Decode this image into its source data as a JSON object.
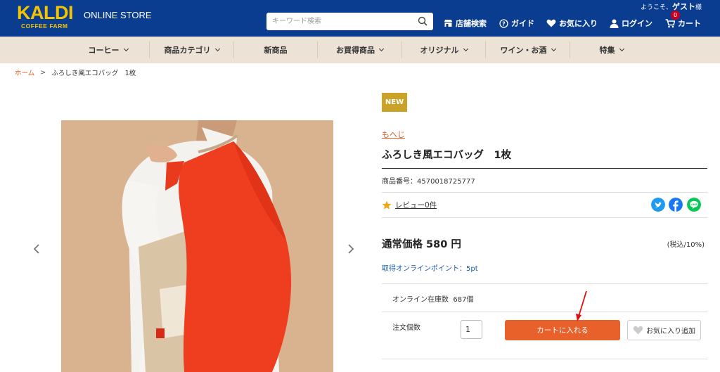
{
  "header": {
    "logo_main": "KALDI",
    "logo_sub": "COFFEE FARM",
    "store_label": "ONLINE STORE",
    "search_placeholder": "キーワード検索",
    "welcome_prefix": "ようこそ、",
    "welcome_user": "ゲスト",
    "welcome_suffix": "様",
    "nav": {
      "stores": "店舗検索",
      "guide": "ガイド",
      "favorites": "お気に入り",
      "login": "ログイン",
      "cart": "カート",
      "cart_count": "0"
    }
  },
  "category_nav": [
    {
      "label": "コーヒー",
      "dropdown": true
    },
    {
      "label": "商品カテゴリ",
      "dropdown": true
    },
    {
      "label": "新商品",
      "dropdown": false
    },
    {
      "label": "お買得商品",
      "dropdown": true
    },
    {
      "label": "オリジナル",
      "dropdown": true
    },
    {
      "label": "ワイン・お酒",
      "dropdown": true
    },
    {
      "label": "特集",
      "dropdown": true
    }
  ],
  "breadcrumb": {
    "home": "ホーム",
    "separator": ">",
    "current": "ふろしき風エコバッグ　1枚"
  },
  "product": {
    "badge": "NEW",
    "brand": "もへじ",
    "title": "ふろしき風エコバッグ　1枚",
    "sku": "商品番号：4570018725777",
    "review": "レビュー0件",
    "price": "通常価格 580 円",
    "tax": "(税込/10%)",
    "points": "取得オンラインポイント：5pt",
    "stock_label": "オンライン在庫数",
    "stock_value": "687個",
    "qty_label": "注文個数",
    "qty_value": "1",
    "cart_button": "カートに入れる",
    "fav_button": "お気に入り追加"
  },
  "colors": {
    "header_bg": "#0a3d8f",
    "logo": "#f5c400",
    "cat_nav_bg": "#ece3d6",
    "accent_orange": "#e8602a",
    "badge_gold": "#c9a227",
    "link_blue": "#1a5ba6"
  },
  "icons": [
    "search-icon",
    "store-icon",
    "help-icon",
    "heart-icon",
    "user-icon",
    "cart-icon",
    "star-icon",
    "twitter-icon",
    "facebook-icon",
    "line-icon",
    "chevron-left-icon",
    "chevron-right-icon"
  ]
}
